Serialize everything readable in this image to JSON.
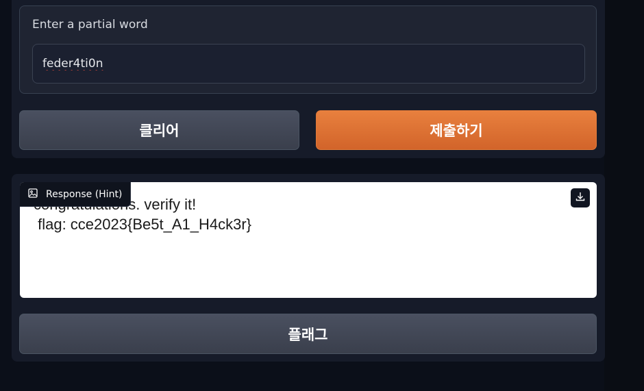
{
  "input_section": {
    "label": "Enter a partial word",
    "value": "feder4ti0n"
  },
  "buttons": {
    "clear_label": "클리어",
    "submit_label": "제출하기",
    "flag_label": "플래그"
  },
  "response": {
    "tag_label": "Response (Hint)",
    "tag_icon": "image-icon",
    "download_icon": "download-icon",
    "text": "congratulations. verify it!\n flag: cce2023{Be5t_A1_H4ck3r}"
  },
  "colors": {
    "background": "#0b0f19",
    "panel": "#161b29",
    "accent_orange": "#e07a3a",
    "secondary_button": "#4a5060"
  }
}
